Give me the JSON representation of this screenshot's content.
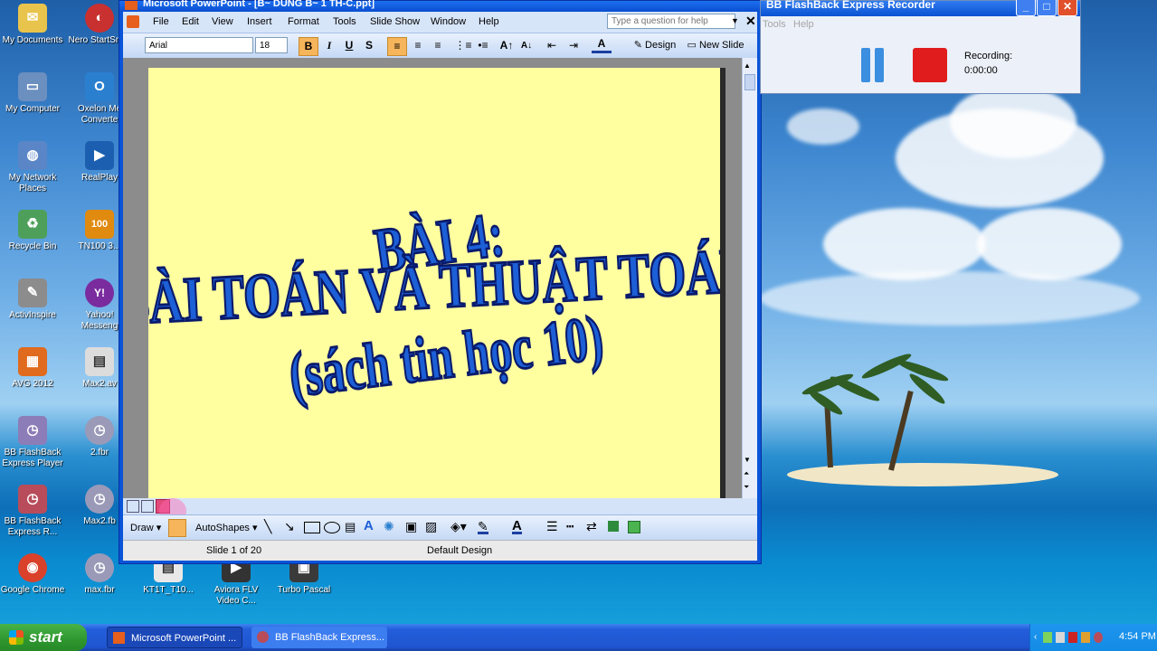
{
  "desktop": {
    "left_icons": [
      {
        "label": "My Documents",
        "color": "#e9c44c",
        "glyph": "✉"
      },
      {
        "label": "My Computer",
        "color": "#6b8fbf",
        "glyph": "▭"
      },
      {
        "label": "My Network Places",
        "color": "#5a86c7",
        "glyph": "◍"
      },
      {
        "label": "Recycle Bin",
        "color": "#4d9f5a",
        "glyph": "♻"
      },
      {
        "label": "ActivInspire",
        "color": "#8c8c8c",
        "glyph": "✎"
      },
      {
        "label": "AVG 2012",
        "color": "#e06a1d",
        "glyph": "▦"
      },
      {
        "label": "BB FlashBack Express Player",
        "color": "#8c7db8",
        "glyph": "◷"
      },
      {
        "label": "BB FlashBack Express R...",
        "color": "#b84c5a",
        "glyph": "◷"
      },
      {
        "label": "Google Chrome",
        "color": "#d9412b",
        "glyph": "◉"
      }
    ],
    "right_icons": [
      {
        "label": "Nero StartSm...",
        "color": "#c93030",
        "glyph": "◐"
      },
      {
        "label": "Oxelon Me Converte",
        "color": "#2a7fcf",
        "glyph": "O"
      },
      {
        "label": "RealPlay",
        "color": "#1c5fb0",
        "glyph": "▶"
      },
      {
        "label": "TN100 3...",
        "color": "#e08a10",
        "glyph": "100"
      },
      {
        "label": "Yahoo! Messeng",
        "color": "#7a2c9e",
        "glyph": "Y!"
      },
      {
        "label": "Max2.av",
        "color": "#dcdcdc",
        "glyph": "▤"
      },
      {
        "label": "2.fbr",
        "color": "#9a9ab8",
        "glyph": "◷"
      },
      {
        "label": "Max2.fb",
        "color": "#9a9ab8",
        "glyph": "◷"
      },
      {
        "label": "max.fbr",
        "color": "#9a9ab8",
        "glyph": "◷"
      }
    ],
    "bottom_icons": [
      {
        "label": "KT1T_T10...",
        "color": "#e8e8e8",
        "glyph": "▤"
      },
      {
        "label": "Aviora FLV Video C...",
        "color": "#333333",
        "glyph": "▶"
      },
      {
        "label": "Turbo Pascal",
        "color": "#3a3a3a",
        "glyph": "▣"
      }
    ]
  },
  "powerpoint": {
    "title": "Microsoft PowerPoint - [B~ DUNG B~ 1 TH-C.ppt]",
    "menus": [
      "File",
      "Edit",
      "View",
      "Insert",
      "Format",
      "Tools",
      "Slide Show",
      "Window",
      "Help"
    ],
    "help_placeholder": "Type a question for help",
    "font_name": "Arial",
    "font_size": "18",
    "bold": "B",
    "italic": "I",
    "underline": "U",
    "shadow": "S",
    "design_label": "Design",
    "new_slide_label": "New Slide",
    "slide": {
      "line1": "BÀI 4:",
      "line2": "BÀI TOÁN VÀ THUẬT TOÁN",
      "line3": "(sách tin học 10)"
    },
    "draw_label": "Draw",
    "autoshapes_label": "AutoShapes",
    "status_slide": "Slide 1 of 20",
    "status_design": "Default Design"
  },
  "recorder": {
    "title": "BB FlashBack Express Recorder",
    "menus": [
      "Tools",
      "Help"
    ],
    "recording_label": "Recording:",
    "recording_time": "0:00:00",
    "pause_color": "#3b8ee0",
    "stop_color": "#e01c1c"
  },
  "taskbar": {
    "start": "start",
    "tasks": [
      {
        "label": "Microsoft PowerPoint ..."
      },
      {
        "label": "BB FlashBack Express..."
      }
    ],
    "clock": "4:54 PM"
  },
  "colors": {
    "title_blue": "#0a54d8",
    "slide_bg": "#ffff9f",
    "wordart_fill": "#1c5fd6",
    "wordart_outline": "#0a1a6b"
  }
}
